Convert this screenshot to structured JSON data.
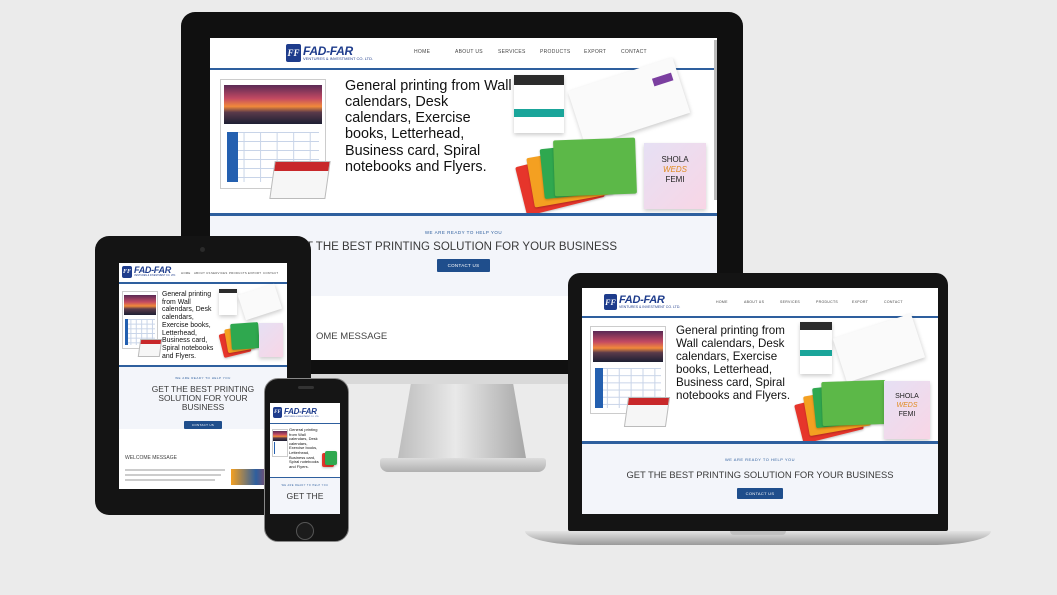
{
  "brand": {
    "name": "FAD-FAR",
    "tagline": "VENTURES & INVESTMENT CO. LTD.",
    "mark": "FF"
  },
  "nav": [
    "HOME",
    "ABOUT US",
    "SERVICES",
    "PRODUCTS",
    "EXPORT",
    "CONTACT"
  ],
  "hero": {
    "text": "General printing from Wall calendars, Desk calendars, Exercise books, Letterhead, Business card, Spiral notebooks and Flyers."
  },
  "cta": {
    "kicker": "WE ARE READY TO HELP YOU",
    "headline": "GET THE BEST PRINTING SOLUTION FOR YOUR BUSINESS",
    "headline_partial": "T THE BEST PRINTING SOLUTION FOR YOUR BUSINESS",
    "phone_headline": "GET THE",
    "button": "CONTACT US"
  },
  "welcome": {
    "title": "WELCOME MESSAGE",
    "partial": "OME MESSAGE"
  },
  "wedding_card": {
    "name1": "SHOLA",
    "weds": "WEDS",
    "name2": "FEMI"
  },
  "colors": {
    "accent": "#2e5f9e",
    "button": "#1f4e8c",
    "background": "#ebebeb"
  }
}
